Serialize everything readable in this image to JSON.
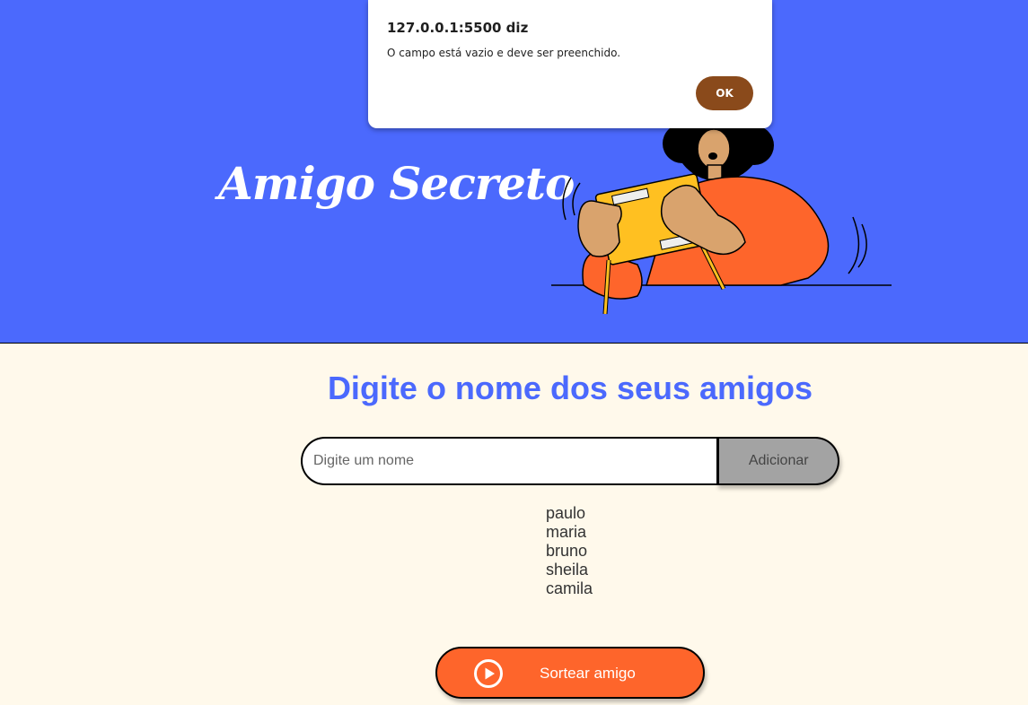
{
  "header": {
    "title": "Amigo Secreto"
  },
  "main": {
    "heading": "Digite o nome dos seus amigos",
    "input": {
      "placeholder": "Digite um nome",
      "value": ""
    },
    "add_label": "Adicionar",
    "friends": [
      "paulo",
      "maria",
      "bruno",
      "sheila",
      "camila"
    ],
    "draw_label": "Sortear amigo"
  },
  "dialog": {
    "title": "127.0.0.1:5500 diz",
    "message": "O campo está vazio e deve ser preenchido.",
    "ok_label": "OK"
  },
  "colors": {
    "header_bg": "#4B69FD",
    "page_bg": "#FFF9EB",
    "accent_orange": "#FE652B",
    "add_button_bg": "#A3A3A3",
    "dialog_ok_bg": "#8A4A1B"
  },
  "icons": {
    "draw_button": "play-circle-icon"
  }
}
